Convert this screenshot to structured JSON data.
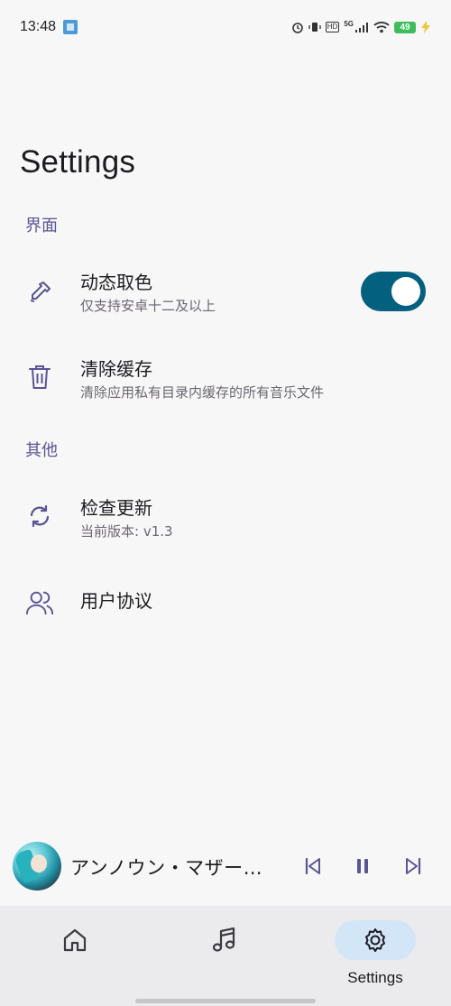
{
  "status_bar": {
    "time": "13:48",
    "network": "5G",
    "hd": "HD",
    "battery": "49"
  },
  "page": {
    "title": "Settings"
  },
  "sections": [
    {
      "header": "界面",
      "items": [
        {
          "icon": "eyedropper-icon",
          "title": "动态取色",
          "subtitle": "仅支持安卓十二及以上",
          "toggle_on": true
        },
        {
          "icon": "trash-icon",
          "title": "清除缓存",
          "subtitle": "清除应用私有目录内缓存的所有音乐文件"
        }
      ]
    },
    {
      "header": "其他",
      "items": [
        {
          "icon": "sync-icon",
          "title": "检查更新",
          "subtitle": "当前版本: v1.3"
        },
        {
          "icon": "users-icon",
          "title": "用户协议"
        }
      ]
    }
  ],
  "player": {
    "track_title": "アンノウン・マザー…",
    "state": "playing"
  },
  "nav": {
    "items": [
      {
        "icon": "home-icon",
        "label": ""
      },
      {
        "icon": "music-icon",
        "label": ""
      },
      {
        "icon": "gear-icon",
        "label": "Settings",
        "active": true
      }
    ]
  },
  "colors": {
    "accent": "#5b5495",
    "toggle": "#04607f",
    "nav_active": "#d3e6f7"
  }
}
